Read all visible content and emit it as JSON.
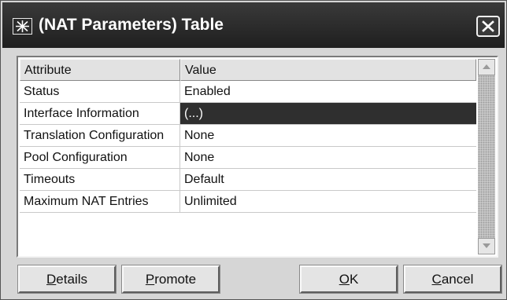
{
  "window": {
    "title": "(NAT Parameters) Table",
    "app_icon": "network-star-icon",
    "close_icon": "close-icon"
  },
  "table": {
    "columns": [
      "Attribute",
      "Value"
    ],
    "rows": [
      {
        "attribute": "Status",
        "value": "Enabled"
      },
      {
        "attribute": "Interface Information",
        "value": "(...)"
      },
      {
        "attribute": "Translation Configuration",
        "value": "None"
      },
      {
        "attribute": "Pool Configuration",
        "value": "None"
      },
      {
        "attribute": "Timeouts",
        "value": "Default"
      },
      {
        "attribute": "Maximum NAT Entries",
        "value": "Unlimited"
      }
    ],
    "selected_row": 1
  },
  "buttons": {
    "details": {
      "mnemonic": "D",
      "rest": "etails"
    },
    "promote": {
      "mnemonic": "P",
      "rest": "romote"
    },
    "ok": {
      "mnemonic": "O",
      "rest": "K"
    },
    "cancel": {
      "mnemonic": "C",
      "rest": "ancel"
    }
  }
}
